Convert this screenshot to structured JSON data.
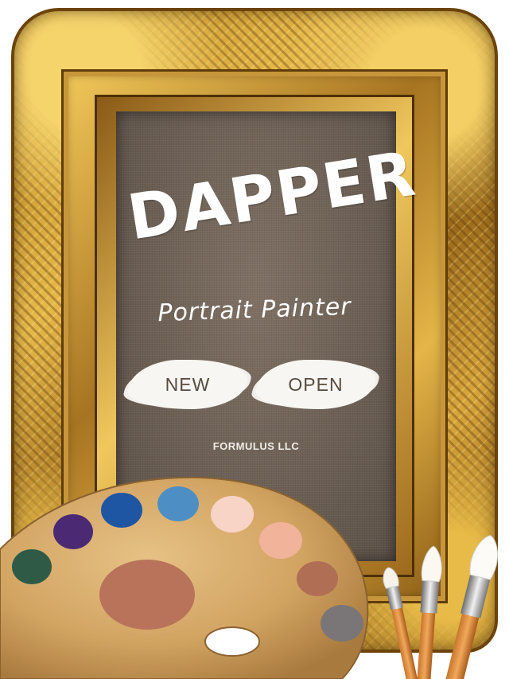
{
  "app": {
    "title": "DAPPER",
    "subtitle": "Portrait Painter",
    "company": "FORMULUS LLC"
  },
  "buttons": {
    "new_label": "NEW",
    "open_label": "OPEN"
  },
  "palette": {
    "paint_colors": [
      "#2e5a46",
      "#4b2a73",
      "#1f56a3",
      "#4d8fc4",
      "#f8d4c6",
      "#f2b39b",
      "#b06e55",
      "#7a7678",
      "#b8735a"
    ]
  },
  "colors": {
    "frame_gold": "#d9a63c",
    "canvas": "#6a5e53",
    "button_text": "#574b40",
    "palette_wood": "#d4a867"
  }
}
